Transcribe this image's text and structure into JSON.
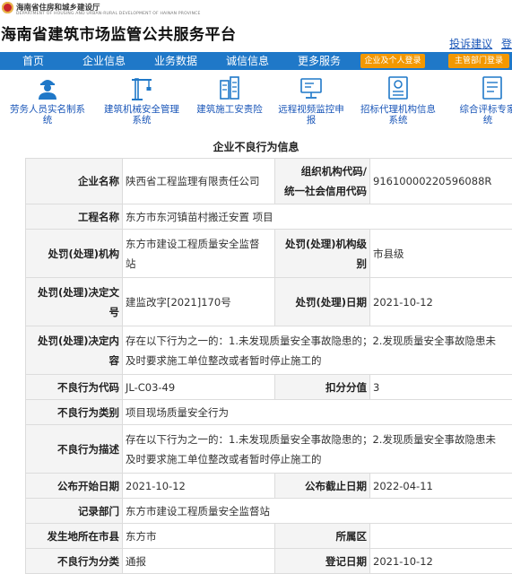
{
  "header": {
    "department": "海南省住房和城乡建设厅",
    "department_en": "DEPARTMENT OF HOUSING AND URBAN-RURAL DEVELOPMENT OF HAINAN PROVINCE",
    "title": "海南省建筑市场监管公共服务平台",
    "links": [
      "投诉建议",
      "登"
    ]
  },
  "nav": {
    "items": [
      "首页",
      "企业信息",
      "业务数据",
      "诚信信息",
      "更多服务"
    ],
    "login_enterprise": "企业及个人登录",
    "login_admin": "主管部门登录"
  },
  "quick_links": [
    {
      "icon": "worker-icon",
      "label": [
        "劳务人员实名制系",
        "统"
      ]
    },
    {
      "icon": "crane-icon",
      "label": [
        "建筑机械安全管理",
        "系统"
      ]
    },
    {
      "icon": "building-insurance-icon",
      "label": [
        "建筑施工安责险",
        ""
      ]
    },
    {
      "icon": "video-monitor-icon",
      "label": [
        "远程视频监控申",
        "报"
      ]
    },
    {
      "icon": "bidding-agent-icon",
      "label": [
        "招标代理机构信息",
        "系统"
      ]
    },
    {
      "icon": "evaluation-expert-icon",
      "label": [
        "综合评标专家",
        "统"
      ]
    }
  ],
  "section_title": "企业不良行为信息",
  "record": {
    "company_name_label": "企业名称",
    "company_name": "陕西省工程监理有限责任公司",
    "org_code_label_1": "组织机构代码/",
    "org_code_label_2": "统一社会信用代码",
    "org_code": "91610000220596088R",
    "project_label": "工程名称",
    "project": "东方市东河镇苗村搬迁安置 项目",
    "agency_label": "处罚(处理)机构",
    "agency_1": "东方市建设工程质量安全监督",
    "agency_2": "站",
    "agency_level_label_1": "处罚(处理)机构级",
    "agency_level_label_2": "别",
    "agency_level": "市县级",
    "doc_no_label_1": "处罚(处理)决定文",
    "doc_no_label_2": "号",
    "doc_no": "建监改字[2021]170号",
    "date_label": "处罚(处理)日期",
    "date": "2021-10-12",
    "content_label_1": "处罚(处理)决定内",
    "content_label_2": "容",
    "content_1": "存在以下行为之一的：1.未发现质量安全事故隐患的；2.发现质量安全事故隐患未",
    "content_2": "及时要求施工单位整改或者暂时停止施工的",
    "code_label": "不良行为代码",
    "code": "JL-C03-49",
    "deduct_label": "扣分分值",
    "deduct": "3",
    "category_label": "不良行为类别",
    "category": "项目现场质量安全行为",
    "desc_label": "不良行为描述",
    "desc_1": "存在以下行为之一的：1.未发现质量安全事故隐患的；2.发现质量安全事故隐患未",
    "desc_2": "及时要求施工单位整改或者暂时停止施工的",
    "pub_start_label": "公布开始日期",
    "pub_start": "2021-10-12",
    "pub_end_label": "公布截止日期",
    "pub_end": "2022-04-11",
    "record_dept_label": "记录部门",
    "record_dept": "东方市建设工程质量安全监督站",
    "city_label": "发生地所在市县",
    "city": "东方市",
    "district_label": "所属区",
    "district": "",
    "classify_label": "不良行为分类",
    "classify": "通报",
    "reg_date_label": "登记日期",
    "reg_date": "2021-10-12"
  },
  "colors": {
    "nav_bg": "#1f78c8",
    "login_btn": "#f39800",
    "link": "#1a56b8",
    "label_bg": "#f4f4f4"
  }
}
